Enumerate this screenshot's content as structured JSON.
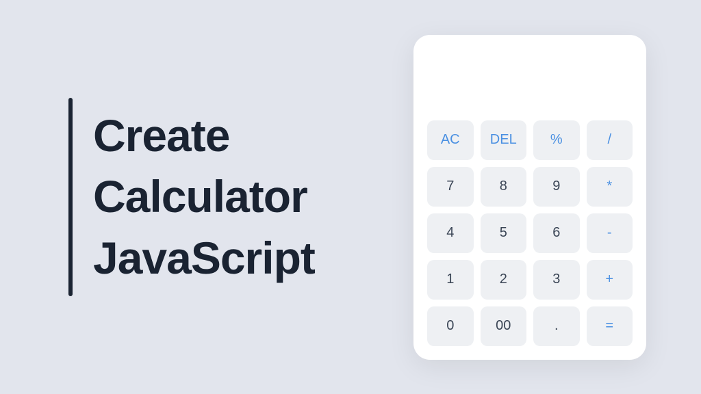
{
  "title": {
    "line1": "Create",
    "line2": "Calculator",
    "line3": "JavaScript"
  },
  "calculator": {
    "buttons": [
      {
        "label": "AC",
        "name": "clear-all-button",
        "accent": true
      },
      {
        "label": "DEL",
        "name": "delete-button",
        "accent": true
      },
      {
        "label": "%",
        "name": "percent-button",
        "accent": true
      },
      {
        "label": "/",
        "name": "divide-button",
        "accent": true
      },
      {
        "label": "7",
        "name": "digit-7-button",
        "accent": false
      },
      {
        "label": "8",
        "name": "digit-8-button",
        "accent": false
      },
      {
        "label": "9",
        "name": "digit-9-button",
        "accent": false
      },
      {
        "label": "*",
        "name": "multiply-button",
        "accent": true
      },
      {
        "label": "4",
        "name": "digit-4-button",
        "accent": false
      },
      {
        "label": "5",
        "name": "digit-5-button",
        "accent": false
      },
      {
        "label": "6",
        "name": "digit-6-button",
        "accent": false
      },
      {
        "label": "-",
        "name": "subtract-button",
        "accent": true
      },
      {
        "label": "1",
        "name": "digit-1-button",
        "accent": false
      },
      {
        "label": "2",
        "name": "digit-2-button",
        "accent": false
      },
      {
        "label": "3",
        "name": "digit-3-button",
        "accent": false
      },
      {
        "label": "+",
        "name": "add-button",
        "accent": true
      },
      {
        "label": "0",
        "name": "digit-0-button",
        "accent": false
      },
      {
        "label": "00",
        "name": "digit-00-button",
        "accent": false
      },
      {
        "label": ".",
        "name": "decimal-button",
        "accent": false
      },
      {
        "label": "=",
        "name": "equals-button",
        "accent": true
      }
    ]
  },
  "colors": {
    "background": "#e2e5ed",
    "text_dark": "#1a2332",
    "button_bg": "#eef0f3",
    "button_text": "#3a4555",
    "accent": "#4a90e2"
  }
}
